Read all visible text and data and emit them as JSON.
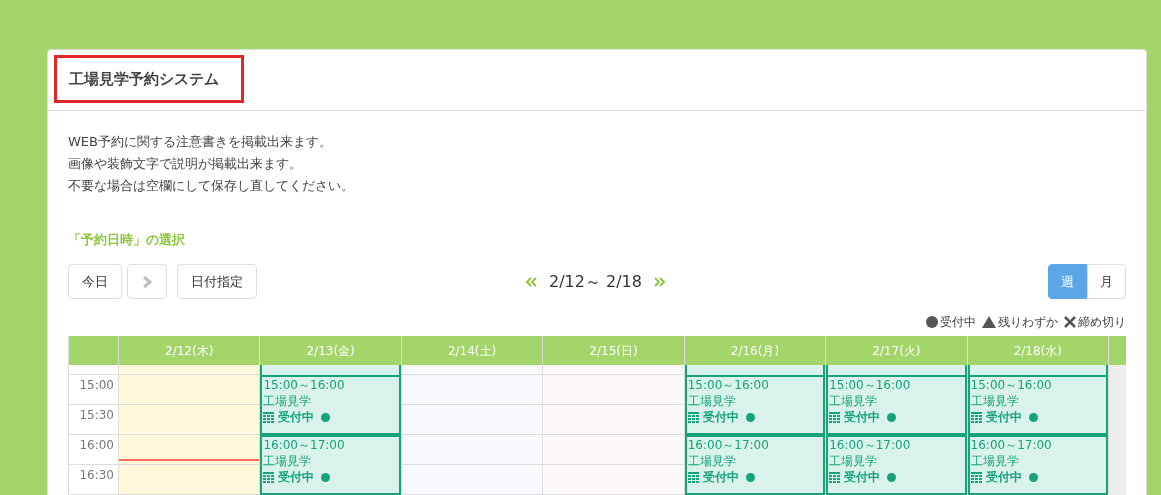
{
  "title": "工場見学予約システム",
  "notice": [
    "WEB予約に関する注意書きを掲載出来ます。",
    "画像や装飾文字で説明が掲載出来ます。",
    "不要な場合は空欄にして保存し直してください。"
  ],
  "section_title": "「予約日時」の選択",
  "toolbar": {
    "today": "今日",
    "next_disabled": true,
    "date_pick": "日付指定",
    "range": "2/12～ 2/18",
    "views": [
      {
        "label": "週",
        "selected": true
      },
      {
        "label": "月",
        "selected": false
      }
    ]
  },
  "legend": [
    {
      "kind": "circle",
      "label": "受付中"
    },
    {
      "kind": "triangle",
      "label": "残りわずか"
    },
    {
      "kind": "cross",
      "label": "締め切り"
    }
  ],
  "time_slots": [
    "15:00",
    "15:30",
    "16:00",
    "16:30"
  ],
  "days": [
    {
      "label": "2/12(木)",
      "kind": "today",
      "now_line": true,
      "earlier_event": false
    },
    {
      "label": "2/13(金)",
      "kind": "weekday",
      "now_line": false,
      "earlier_event": true,
      "events": [
        {
          "time": "15:00～16:00",
          "title": "工場見学",
          "status": "受付中"
        },
        {
          "time": "16:00～17:00",
          "title": "工場見学",
          "status": "受付中"
        }
      ]
    },
    {
      "label": "2/14(土)",
      "kind": "saturday",
      "now_line": false,
      "earlier_event": false
    },
    {
      "label": "2/15(日)",
      "kind": "sunday",
      "now_line": false,
      "earlier_event": false
    },
    {
      "label": "2/16(月)",
      "kind": "weekday",
      "now_line": false,
      "earlier_event": true,
      "events": [
        {
          "time": "15:00～16:00",
          "title": "工場見学",
          "status": "受付中"
        },
        {
          "time": "16:00～17:00",
          "title": "工場見学",
          "status": "受付中"
        }
      ]
    },
    {
      "label": "2/17(火)",
      "kind": "weekday",
      "now_line": false,
      "earlier_event": true,
      "events": [
        {
          "time": "15:00～16:00",
          "title": "工場見学",
          "status": "受付中"
        },
        {
          "time": "16:00～17:00",
          "title": "工場見学",
          "status": "受付中"
        }
      ]
    },
    {
      "label": "2/18(水)",
      "kind": "weekday",
      "now_line": false,
      "earlier_event": true,
      "events": [
        {
          "time": "15:00～16:00",
          "title": "工場見学",
          "status": "受付中"
        },
        {
          "time": "16:00～17:00",
          "title": "工場見学",
          "status": "受付中"
        }
      ]
    }
  ]
}
